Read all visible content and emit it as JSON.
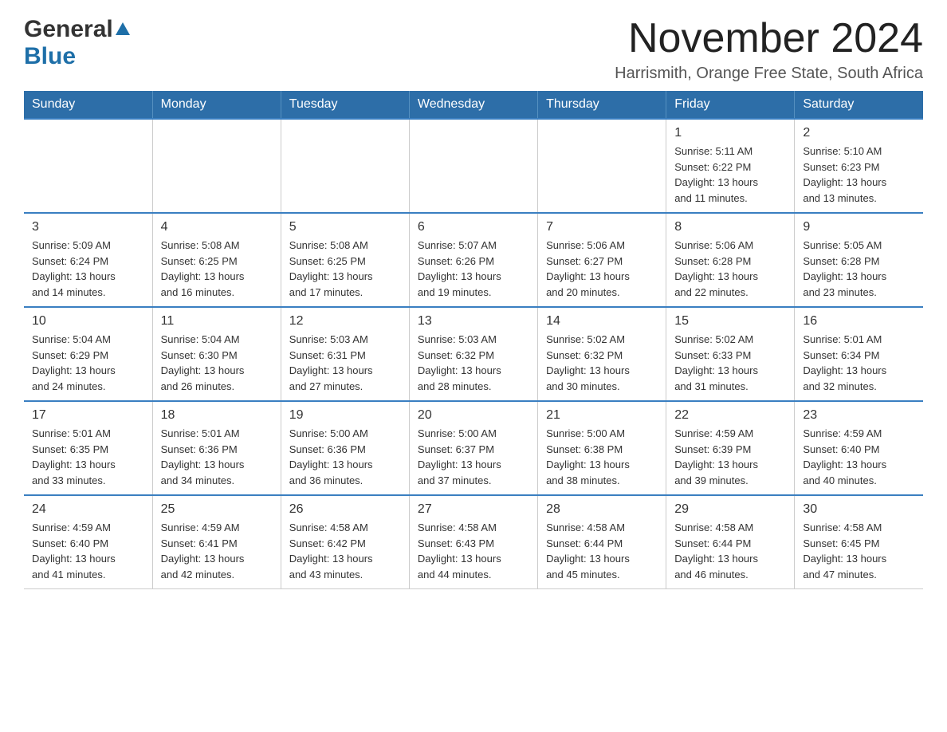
{
  "header": {
    "logo_general": "General",
    "logo_blue": "Blue",
    "month_title": "November 2024",
    "location": "Harrismith, Orange Free State, South Africa"
  },
  "calendar": {
    "days_of_week": [
      "Sunday",
      "Monday",
      "Tuesday",
      "Wednesday",
      "Thursday",
      "Friday",
      "Saturday"
    ],
    "weeks": [
      [
        {
          "day": "",
          "info": ""
        },
        {
          "day": "",
          "info": ""
        },
        {
          "day": "",
          "info": ""
        },
        {
          "day": "",
          "info": ""
        },
        {
          "day": "",
          "info": ""
        },
        {
          "day": "1",
          "info": "Sunrise: 5:11 AM\nSunset: 6:22 PM\nDaylight: 13 hours\nand 11 minutes."
        },
        {
          "day": "2",
          "info": "Sunrise: 5:10 AM\nSunset: 6:23 PM\nDaylight: 13 hours\nand 13 minutes."
        }
      ],
      [
        {
          "day": "3",
          "info": "Sunrise: 5:09 AM\nSunset: 6:24 PM\nDaylight: 13 hours\nand 14 minutes."
        },
        {
          "day": "4",
          "info": "Sunrise: 5:08 AM\nSunset: 6:25 PM\nDaylight: 13 hours\nand 16 minutes."
        },
        {
          "day": "5",
          "info": "Sunrise: 5:08 AM\nSunset: 6:25 PM\nDaylight: 13 hours\nand 17 minutes."
        },
        {
          "day": "6",
          "info": "Sunrise: 5:07 AM\nSunset: 6:26 PM\nDaylight: 13 hours\nand 19 minutes."
        },
        {
          "day": "7",
          "info": "Sunrise: 5:06 AM\nSunset: 6:27 PM\nDaylight: 13 hours\nand 20 minutes."
        },
        {
          "day": "8",
          "info": "Sunrise: 5:06 AM\nSunset: 6:28 PM\nDaylight: 13 hours\nand 22 minutes."
        },
        {
          "day": "9",
          "info": "Sunrise: 5:05 AM\nSunset: 6:28 PM\nDaylight: 13 hours\nand 23 minutes."
        }
      ],
      [
        {
          "day": "10",
          "info": "Sunrise: 5:04 AM\nSunset: 6:29 PM\nDaylight: 13 hours\nand 24 minutes."
        },
        {
          "day": "11",
          "info": "Sunrise: 5:04 AM\nSunset: 6:30 PM\nDaylight: 13 hours\nand 26 minutes."
        },
        {
          "day": "12",
          "info": "Sunrise: 5:03 AM\nSunset: 6:31 PM\nDaylight: 13 hours\nand 27 minutes."
        },
        {
          "day": "13",
          "info": "Sunrise: 5:03 AM\nSunset: 6:32 PM\nDaylight: 13 hours\nand 28 minutes."
        },
        {
          "day": "14",
          "info": "Sunrise: 5:02 AM\nSunset: 6:32 PM\nDaylight: 13 hours\nand 30 minutes."
        },
        {
          "day": "15",
          "info": "Sunrise: 5:02 AM\nSunset: 6:33 PM\nDaylight: 13 hours\nand 31 minutes."
        },
        {
          "day": "16",
          "info": "Sunrise: 5:01 AM\nSunset: 6:34 PM\nDaylight: 13 hours\nand 32 minutes."
        }
      ],
      [
        {
          "day": "17",
          "info": "Sunrise: 5:01 AM\nSunset: 6:35 PM\nDaylight: 13 hours\nand 33 minutes."
        },
        {
          "day": "18",
          "info": "Sunrise: 5:01 AM\nSunset: 6:36 PM\nDaylight: 13 hours\nand 34 minutes."
        },
        {
          "day": "19",
          "info": "Sunrise: 5:00 AM\nSunset: 6:36 PM\nDaylight: 13 hours\nand 36 minutes."
        },
        {
          "day": "20",
          "info": "Sunrise: 5:00 AM\nSunset: 6:37 PM\nDaylight: 13 hours\nand 37 minutes."
        },
        {
          "day": "21",
          "info": "Sunrise: 5:00 AM\nSunset: 6:38 PM\nDaylight: 13 hours\nand 38 minutes."
        },
        {
          "day": "22",
          "info": "Sunrise: 4:59 AM\nSunset: 6:39 PM\nDaylight: 13 hours\nand 39 minutes."
        },
        {
          "day": "23",
          "info": "Sunrise: 4:59 AM\nSunset: 6:40 PM\nDaylight: 13 hours\nand 40 minutes."
        }
      ],
      [
        {
          "day": "24",
          "info": "Sunrise: 4:59 AM\nSunset: 6:40 PM\nDaylight: 13 hours\nand 41 minutes."
        },
        {
          "day": "25",
          "info": "Sunrise: 4:59 AM\nSunset: 6:41 PM\nDaylight: 13 hours\nand 42 minutes."
        },
        {
          "day": "26",
          "info": "Sunrise: 4:58 AM\nSunset: 6:42 PM\nDaylight: 13 hours\nand 43 minutes."
        },
        {
          "day": "27",
          "info": "Sunrise: 4:58 AM\nSunset: 6:43 PM\nDaylight: 13 hours\nand 44 minutes."
        },
        {
          "day": "28",
          "info": "Sunrise: 4:58 AM\nSunset: 6:44 PM\nDaylight: 13 hours\nand 45 minutes."
        },
        {
          "day": "29",
          "info": "Sunrise: 4:58 AM\nSunset: 6:44 PM\nDaylight: 13 hours\nand 46 minutes."
        },
        {
          "day": "30",
          "info": "Sunrise: 4:58 AM\nSunset: 6:45 PM\nDaylight: 13 hours\nand 47 minutes."
        }
      ]
    ]
  }
}
